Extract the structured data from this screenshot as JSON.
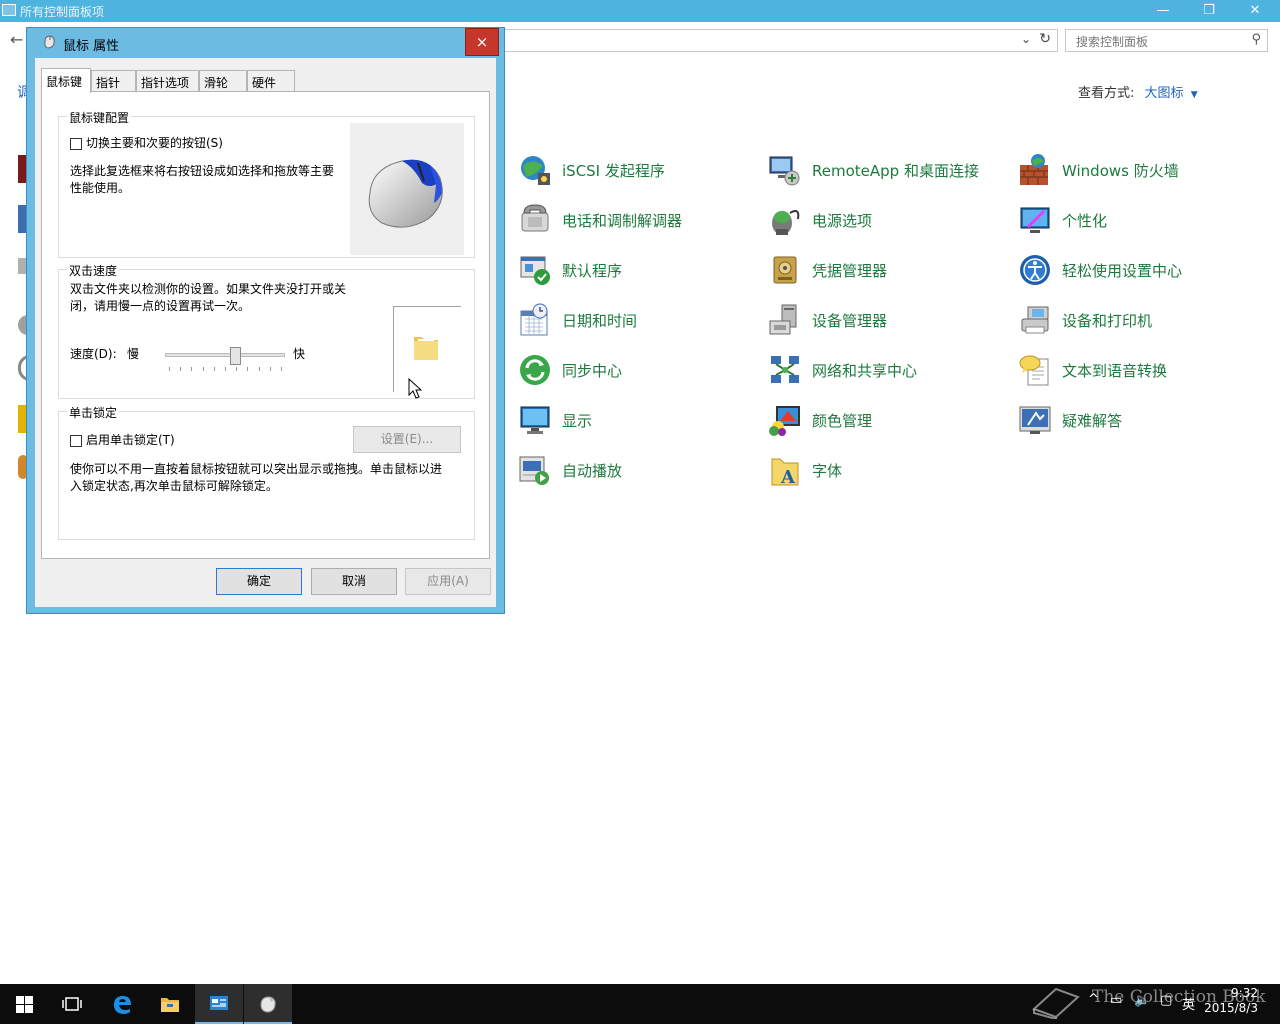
{
  "control_panel": {
    "title": "所有控制面板项",
    "search_placeholder": "搜索控制面板",
    "left_hint": "调",
    "view_by_label": "查看方式:",
    "view_by_value": "大图标",
    "items": [
      {
        "label": "iSCSI 发起程序",
        "icon": "iscsi-icon"
      },
      {
        "label": "RemoteApp 和桌面连接",
        "icon": "remoteapp-icon"
      },
      {
        "label": "Windows 防火墙",
        "icon": "firewall-icon"
      },
      {
        "label": "电话和调制解调器",
        "icon": "phone-modem-icon"
      },
      {
        "label": "电源选项",
        "icon": "power-icon"
      },
      {
        "label": "个性化",
        "icon": "personalization-icon"
      },
      {
        "label": "默认程序",
        "icon": "default-programs-icon"
      },
      {
        "label": "凭据管理器",
        "icon": "credential-manager-icon"
      },
      {
        "label": "轻松使用设置中心",
        "icon": "ease-of-access-icon"
      },
      {
        "label": "日期和时间",
        "icon": "date-time-icon"
      },
      {
        "label": "设备管理器",
        "icon": "device-manager-icon"
      },
      {
        "label": "设备和打印机",
        "icon": "devices-printers-icon"
      },
      {
        "label": "同步中心",
        "icon": "sync-center-icon"
      },
      {
        "label": "网络和共享中心",
        "icon": "network-sharing-icon"
      },
      {
        "label": "文本到语音转换",
        "icon": "text-to-speech-icon"
      },
      {
        "label": "显示",
        "icon": "display-icon"
      },
      {
        "label": "颜色管理",
        "icon": "color-management-icon"
      },
      {
        "label": "疑难解答",
        "icon": "troubleshooting-icon"
      },
      {
        "label": "自动播放",
        "icon": "autoplay-icon"
      },
      {
        "label": "字体",
        "icon": "fonts-icon"
      }
    ]
  },
  "dialog": {
    "title": "鼠标 属性",
    "close": "×",
    "tabs": [
      "鼠标键",
      "指针",
      "指针选项",
      "滑轮",
      "硬件"
    ],
    "button_config": {
      "legend": "鼠标键配置",
      "checkbox_label": "切换主要和次要的按钮(S)",
      "checked": false,
      "description_line1": "选择此复选框来将右按钮设成如选择和拖放等主要",
      "description_line2": "性能使用。"
    },
    "double_click": {
      "legend": "双击速度",
      "description_line1": "双击文件夹以检测你的设置。如果文件夹没打开或关",
      "description_line2": "闭，请用慢一点的设置再试一次。",
      "speed_label": "速度(D):",
      "slow": "慢",
      "fast": "快",
      "speed_value": 0.58
    },
    "click_lock": {
      "legend": "单击锁定",
      "checkbox_label": "启用单击锁定(T)",
      "checked": false,
      "settings_button": "设置(E)...",
      "description_line1": "使你可以不用一直按着鼠标按钮就可以突出显示或拖拽。单击鼠标以进",
      "description_line2": "入锁定状态,再次单击鼠标可解除锁定。"
    },
    "ok": "确定",
    "cancel": "取消",
    "apply": "应用(A)"
  },
  "taskbar": {
    "tray_caret": "^",
    "ime": "英",
    "time": "9:32",
    "date": "2015/8/3",
    "watermark": "The Collection Book"
  },
  "colors": {
    "link_green": "#1d7a3e",
    "accent_blue": "#4fb3e0",
    "close_red": "#c7362c"
  }
}
